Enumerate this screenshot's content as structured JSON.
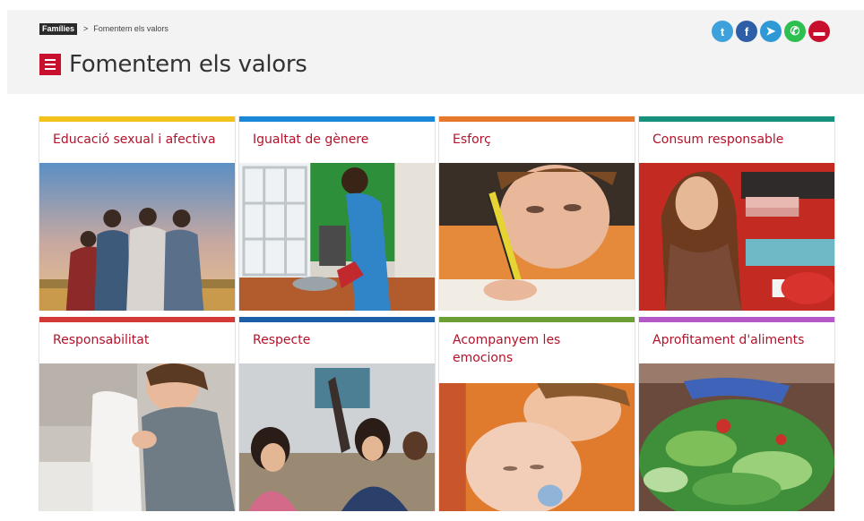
{
  "breadcrumb": {
    "home": "Famílies",
    "separator": ">",
    "current": "Fomentem els valors"
  },
  "page": {
    "title": "Fomentem els valors"
  },
  "share": [
    {
      "name": "twitter",
      "glyph": "t",
      "color": "#3fa1db"
    },
    {
      "name": "facebook",
      "glyph": "f",
      "color": "#2d5ea7"
    },
    {
      "name": "telegram",
      "glyph": "➤",
      "color": "#2f99d6"
    },
    {
      "name": "whatsapp",
      "glyph": "✆",
      "color": "#2dbf4f"
    },
    {
      "name": "print",
      "glyph": "▬",
      "color": "#c8102e"
    }
  ],
  "cards": [
    {
      "label": "Educació sexual i afectiva",
      "accent": "#f2c21b"
    },
    {
      "label": "Igualtat de gènere",
      "accent": "#1b87d8"
    },
    {
      "label": "Esforç",
      "accent": "#e5782b"
    },
    {
      "label": "Consum responsable",
      "accent": "#17917e"
    },
    {
      "label": "Responsabilitat",
      "accent": "#d13a37"
    },
    {
      "label": "Respecte",
      "accent": "#1c5fa8"
    },
    {
      "label": "Acompanyem les emocions",
      "accent": "#6b9e34"
    },
    {
      "label": "Aprofitament d'aliments",
      "accent": "#b558c7"
    }
  ]
}
